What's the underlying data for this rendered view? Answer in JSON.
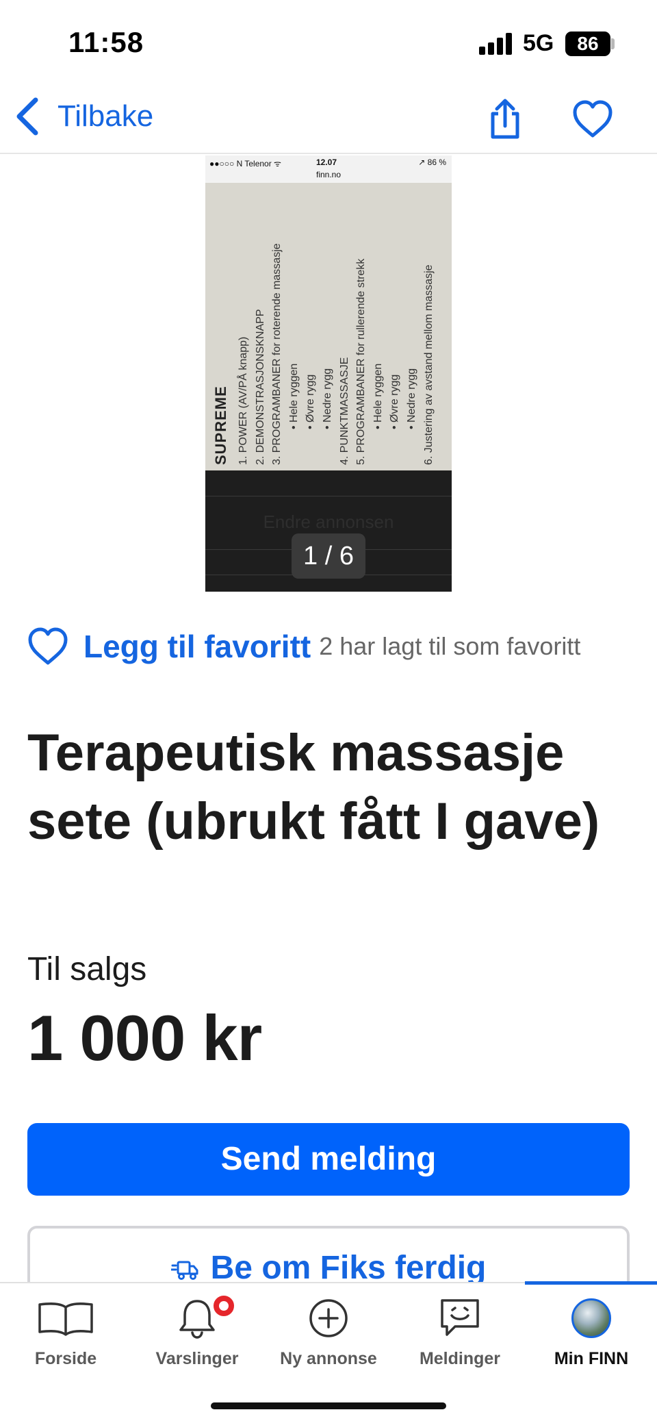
{
  "status_bar": {
    "time": "11:58",
    "network": "5G",
    "battery": "86"
  },
  "nav": {
    "back_label": "Tilbake",
    "icons": [
      "chevron-left-icon",
      "share-icon",
      "heart-outline-icon"
    ]
  },
  "gallery": {
    "photo": {
      "carrier": "●●○○○ N Telenor ᯤ",
      "time": "12.07",
      "battery": "↗ 86 %",
      "url": "finn.no",
      "heading": "SUPREME",
      "lines": [
        "1. POWER (AV/PÅ knapp)",
        "2. DEMONSTRASJONSKNAPP",
        "3. PROGRAMBANER for roterende massasje",
        "• Hele ryggen",
        "• Øvre rygg",
        "• Nedre rygg",
        "4. PUNKTMASSASJE",
        "5. PROGRAMBANER for rullerende strekk",
        "• Hele ryggen",
        "• Øvre rygg",
        "• Nedre rygg",
        "6. Justering av avstand mellom massasje"
      ],
      "ghost_text": "Endre annonsen"
    },
    "counter": "1 / 6"
  },
  "favorite": {
    "link_label": "Legg til favoritt",
    "count_text": "2 har lagt til som favoritt"
  },
  "listing": {
    "title": "Terapeutisk massasje sete (ubrukt fått I gave)",
    "sale_type": "Til salgs",
    "price": "1 000 kr"
  },
  "actions": {
    "send_message": "Send melding",
    "fiks_ferdig": "Be om Fiks ferdig"
  },
  "tab_bar": {
    "active_color": "#1565e0",
    "tabs": [
      {
        "label": "Forside",
        "icon": "book-icon"
      },
      {
        "label": "Varslinger",
        "icon": "bell-icon"
      },
      {
        "label": "Ny annonse",
        "icon": "plus-circle-icon"
      },
      {
        "label": "Meldinger",
        "icon": "chat-smile-icon"
      },
      {
        "label": "Min FINN",
        "icon": "avatar"
      }
    ]
  },
  "colors": {
    "brand_blue": "#0063fb",
    "link_blue": "#1565e0",
    "badge_red": "#e5262b"
  }
}
